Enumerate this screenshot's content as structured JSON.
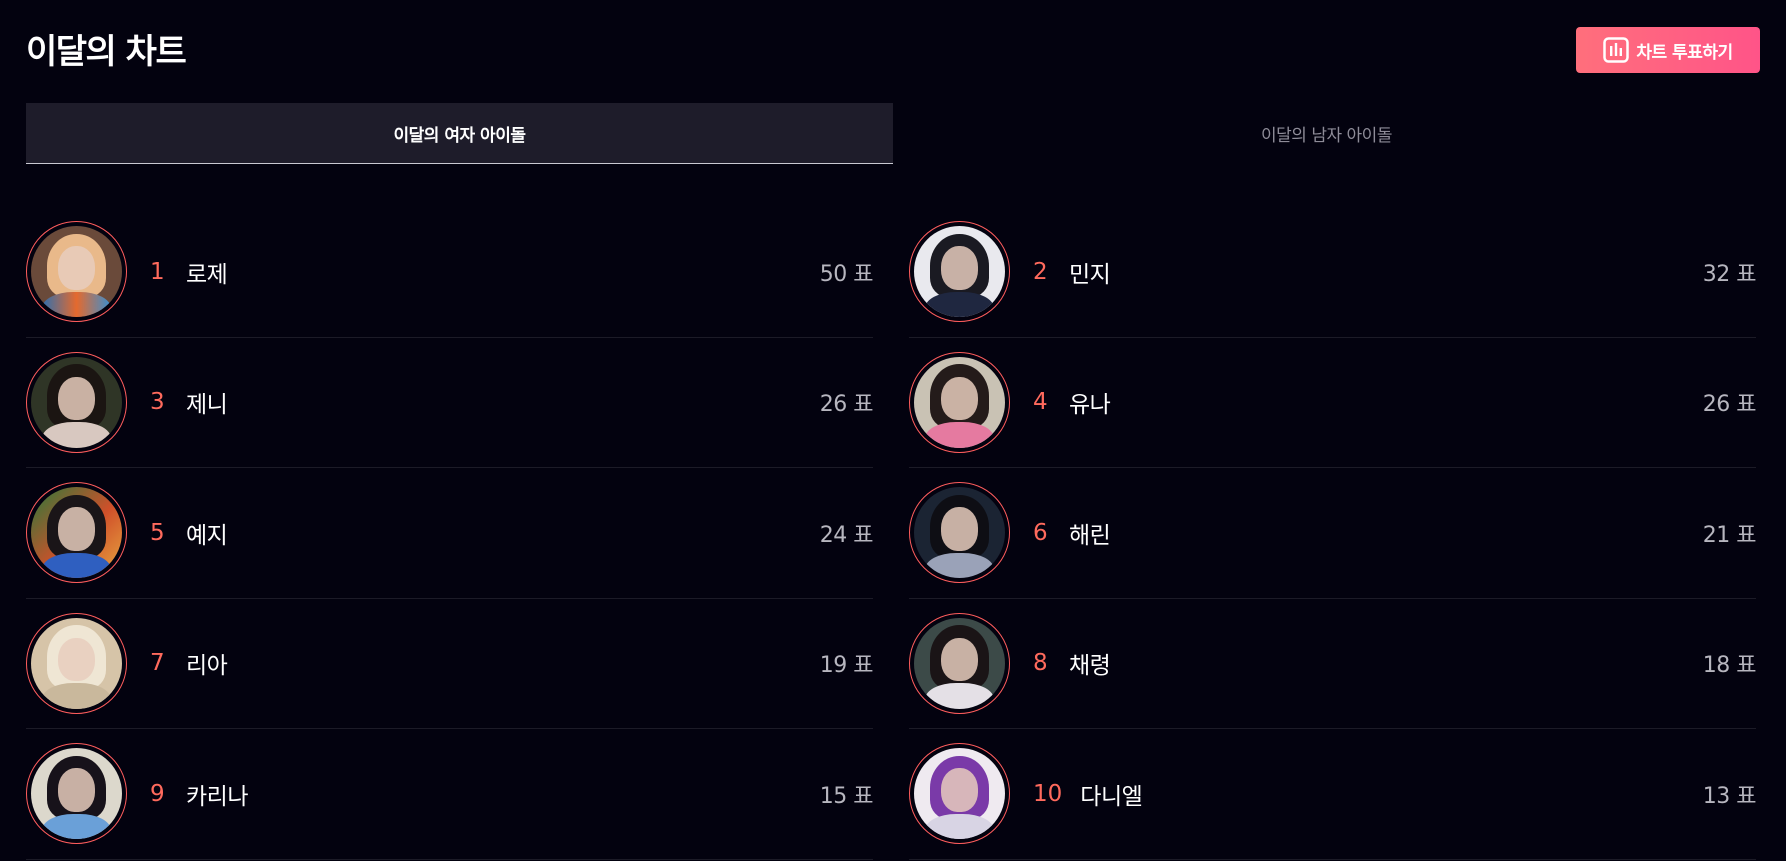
{
  "header": {
    "title": "이달의 차트",
    "vote_button_label": "차트 투표하기"
  },
  "tabs": [
    {
      "label": "이달의 여자 아이돌",
      "active": true
    },
    {
      "label": "이달의 남자 아이돌",
      "active": false
    }
  ],
  "colors": {
    "background": "#03020f",
    "accent": "#ff5d5d",
    "button_gradient_start": "#ff6f7c",
    "button_gradient_end": "#ff5488"
  },
  "chart": [
    {
      "rank": "1",
      "name": "로제",
      "votes": "50 표"
    },
    {
      "rank": "2",
      "name": "민지",
      "votes": "32 표"
    },
    {
      "rank": "3",
      "name": "제니",
      "votes": "26 표"
    },
    {
      "rank": "4",
      "name": "유나",
      "votes": "26 표"
    },
    {
      "rank": "5",
      "name": "예지",
      "votes": "24 표"
    },
    {
      "rank": "6",
      "name": "해린",
      "votes": "21 표"
    },
    {
      "rank": "7",
      "name": "리아",
      "votes": "19 표"
    },
    {
      "rank": "8",
      "name": "채령",
      "votes": "18 표"
    },
    {
      "rank": "9",
      "name": "카리나",
      "votes": "15 표"
    },
    {
      "rank": "10",
      "name": "다니엘",
      "votes": "13 표"
    }
  ]
}
